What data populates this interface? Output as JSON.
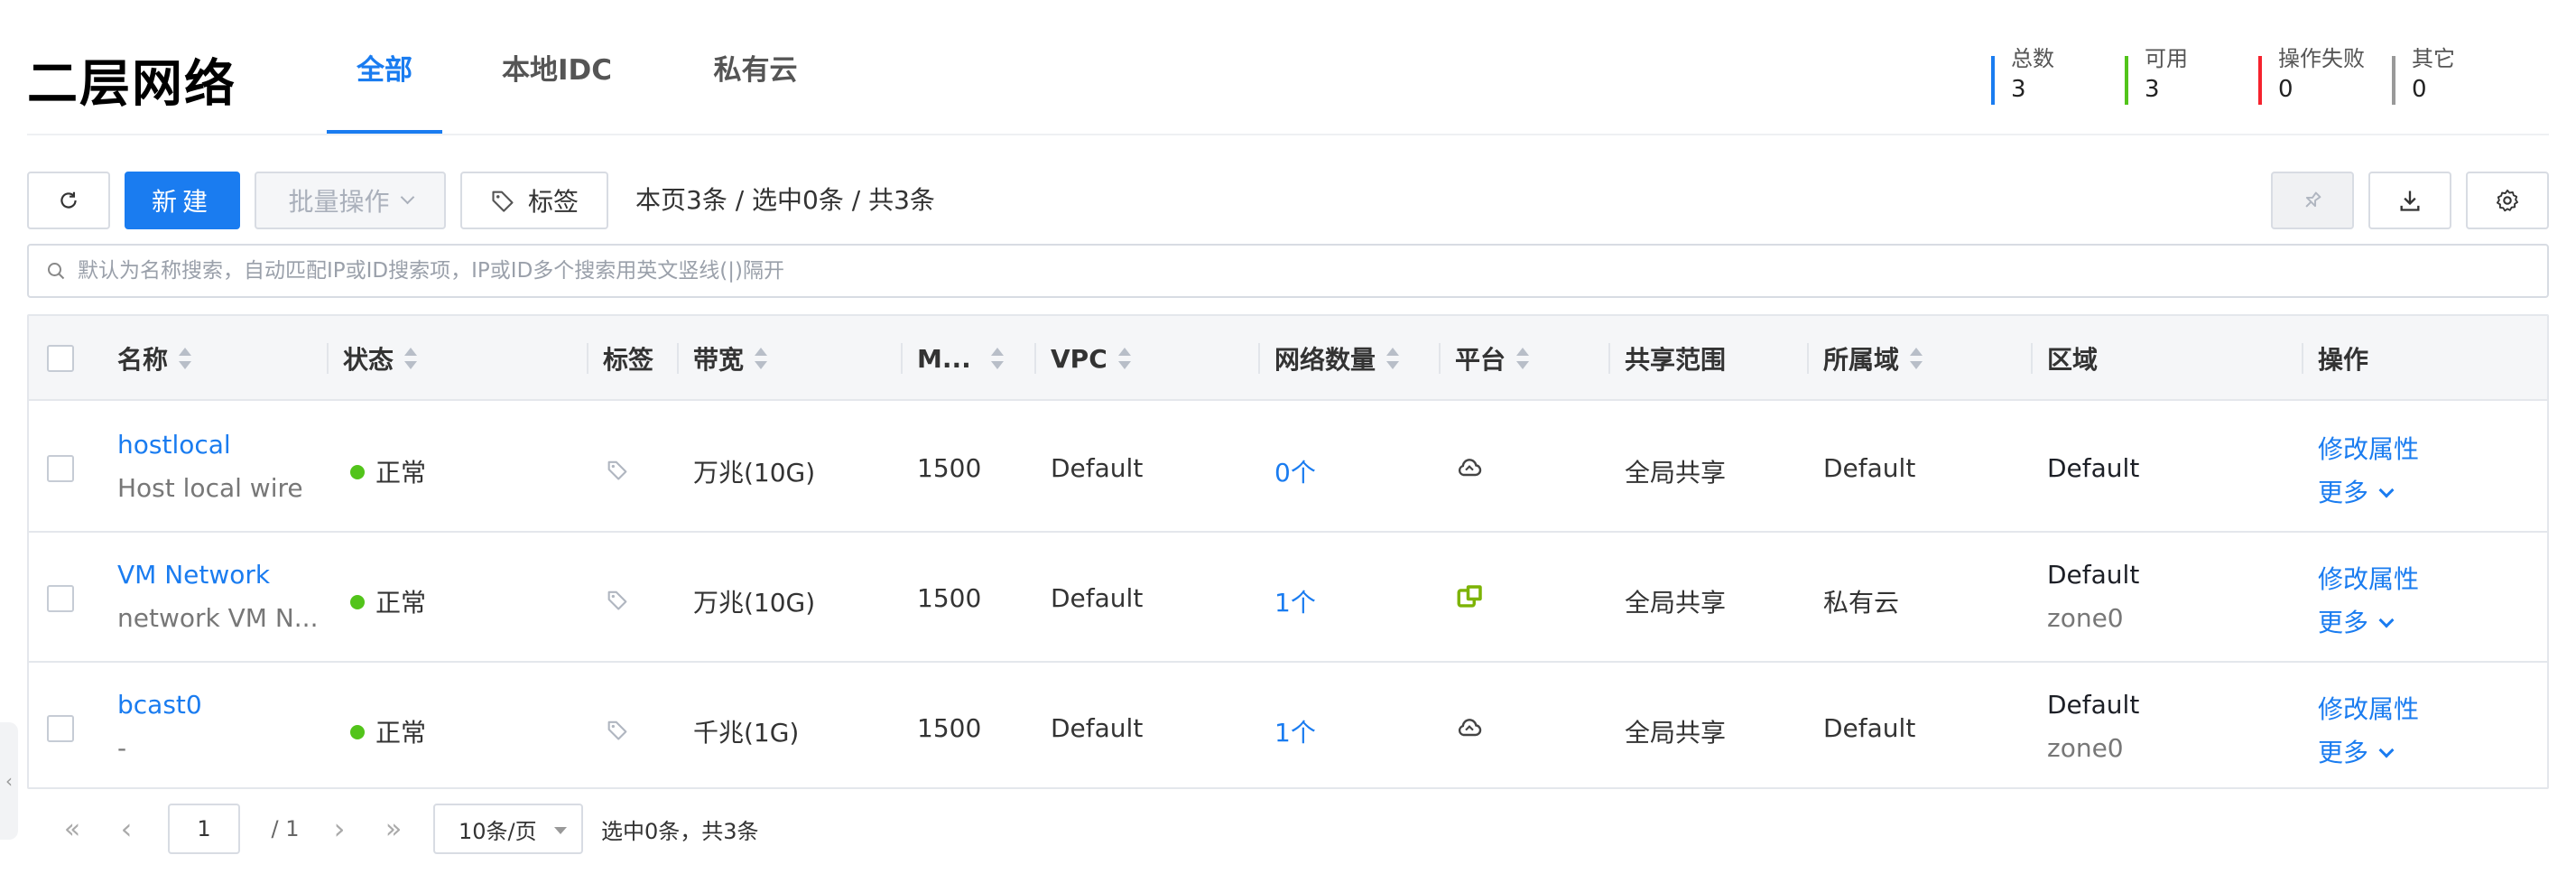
{
  "page": {
    "title": "二层网络"
  },
  "tabs": [
    {
      "label": "全部",
      "active": true
    },
    {
      "label": "本地IDC",
      "active": false
    },
    {
      "label": "私有云",
      "active": false
    }
  ],
  "stats": [
    {
      "label": "总数",
      "value": "3",
      "color": "#1a7cf0"
    },
    {
      "label": "可用",
      "value": "3",
      "color": "#52c41a"
    },
    {
      "label": "操作失败",
      "value": "0",
      "color": "#f5222d"
    },
    {
      "label": "其它",
      "value": "0",
      "color": "#999999"
    }
  ],
  "toolbar": {
    "refresh_icon": "refresh-icon",
    "new_label": "新建",
    "batch_label": "批量操作",
    "tag_label": "标签",
    "count_text": "本页3条 / 选中0条 / 共3条",
    "pin_icon": "pin-icon",
    "download_icon": "download-icon",
    "settings_icon": "gear-icon"
  },
  "search": {
    "placeholder": "默认为名称搜索，自动匹配IP或ID搜索项，IP或ID多个搜索用英文竖线(|)隔开"
  },
  "table": {
    "columns": {
      "name": "名称",
      "status": "状态",
      "tags": "标签",
      "bandwidth": "带宽",
      "mtu": "M...",
      "vpc": "VPC",
      "networks": "网络数量",
      "platform": "平台",
      "share": "共享范围",
      "domain": "所属域",
      "zone": "区域",
      "actions": "操作"
    },
    "rows": [
      {
        "name": "hostlocal",
        "desc": "Host local wire",
        "status": "正常",
        "bandwidth": "万兆(10G)",
        "mtu": "1500",
        "vpc": "Default",
        "networks": "0个",
        "platform": "cloud-icon",
        "share": "全局共享",
        "domain": "Default",
        "zone_top": "Default",
        "zone_bottom": "",
        "action": "修改属性",
        "more": "更多"
      },
      {
        "name": "VM Network",
        "desc": "network VM N...",
        "status": "正常",
        "bandwidth": "万兆(10G)",
        "mtu": "1500",
        "vpc": "Default",
        "networks": "1个",
        "platform": "vmware-icon",
        "share": "全局共享",
        "domain": "私有云",
        "zone_top": "Default",
        "zone_bottom": "zone0",
        "action": "修改属性",
        "more": "更多"
      },
      {
        "name": "bcast0",
        "desc": "-",
        "status": "正常",
        "bandwidth": "千兆(1G)",
        "mtu": "1500",
        "vpc": "Default",
        "networks": "1个",
        "platform": "cloud-icon",
        "share": "全局共享",
        "domain": "Default",
        "zone_top": "Default",
        "zone_bottom": "zone0",
        "action": "修改属性",
        "more": "更多"
      }
    ]
  },
  "pager": {
    "page": "1",
    "total_pages": "/ 1",
    "page_size": "10条/页",
    "summary": "选中0条，共3条"
  },
  "colors": {
    "accent": "#1a7cf0",
    "ok": "#52c41a",
    "vmware": "#7cb305"
  }
}
